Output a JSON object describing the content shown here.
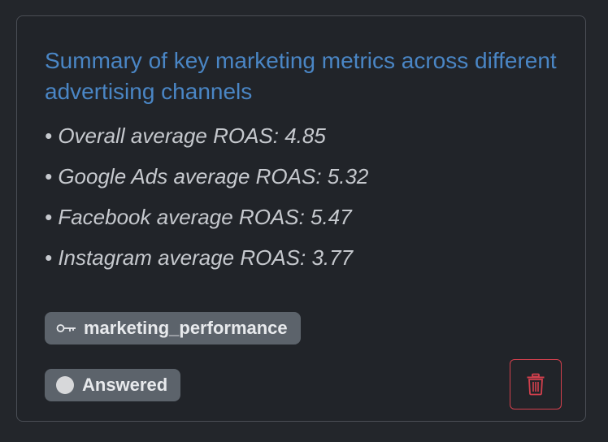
{
  "card": {
    "title": "Summary of key marketing metrics across different advertising channels",
    "bullets": [
      "• Overall average ROAS: 4.85",
      "• Google Ads average ROAS: 5.32",
      "• Facebook average ROAS: 5.47",
      "• Instagram average ROAS: 3.77"
    ],
    "key_tag": {
      "icon": "key-icon",
      "label": "marketing_performance"
    },
    "status_tag": {
      "icon": "status-dot-icon",
      "label": "Answered"
    },
    "delete_button": {
      "icon": "trash-icon"
    }
  },
  "colors": {
    "background": "#23262b",
    "card_border": "#4a4e55",
    "title": "#4a86c5",
    "bullet_text": "#c6c9ce",
    "tag_background": "#5c636b",
    "danger": "#d2404d"
  }
}
